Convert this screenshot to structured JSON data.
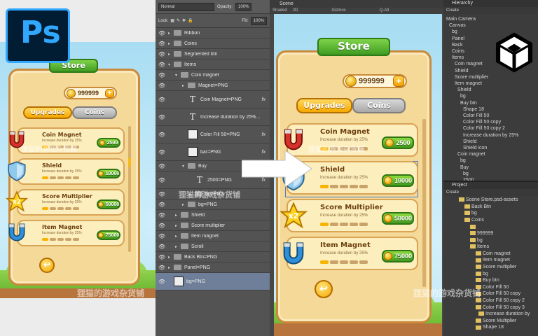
{
  "ps_logo": "Ps",
  "store_title": "Store",
  "coins_amount": "999999",
  "plus_label": "+",
  "tabs": {
    "upgrades": "Upgrades",
    "coins": "Coins"
  },
  "items": [
    {
      "title": "Coin Magnet",
      "desc": "Increase duration by 25%",
      "price": "2500",
      "level": 1,
      "icon": "horseshoe-magnet-icon"
    },
    {
      "title": "Shield",
      "desc": "Increase duration by 25%",
      "price": "10000",
      "level": 1,
      "icon": "shield-icon"
    },
    {
      "title": "Score Multiplier",
      "desc": "Increase duration by 25%",
      "price": "50000",
      "level": 1,
      "icon": "star-multiplier-icon"
    },
    {
      "title": "Item Magnet",
      "desc": "Increase duration by 25%",
      "price": "75000",
      "level": 1,
      "icon": "u-magnet-icon"
    }
  ],
  "back_label": "↩",
  "photoshop": {
    "blend_mode": "Normal",
    "opacity_label": "Opacity:",
    "opacity_value": "100%",
    "lock_label": "Lock:",
    "fill_label": "Fill:",
    "fill_value": "100%",
    "layers": [
      "Ribbon",
      "Coins",
      "Segmented btn",
      "Items",
      "Coin magnet",
      "Magnet=PNG",
      "Coin Magnet=PNG",
      "Increase duration by 25%...",
      "Color Fill 50=PNG",
      "bar=PNG",
      "Buy",
      "2500=PNG",
      "bg=PNG",
      "bg=PNG",
      "Shield",
      "Score multiplier",
      "Item magnet",
      "Scroll",
      "Back Btn=PNG",
      "Panel=PNG",
      "bg=PNG"
    ]
  },
  "unity": {
    "scene_tab": "Scene",
    "scene_toolbar": [
      "Shaded",
      "2D",
      "Gizmos",
      "Q-All"
    ],
    "hierarchy_tab": "Hierarchy",
    "hierarchy_create": "Create",
    "hierarchy": [
      "Main Camera",
      "Canvas",
      "bg",
      "Panel",
      "Back",
      "Coins",
      "Items",
      "Coin magnet",
      "Shield",
      "Score multiplier",
      "Item magnet",
      "Shield",
      "bg",
      "Buy btn",
      "Shape 18",
      "Color Fill 50",
      "Color Fill 50 copy",
      "Color Fill 50 copy 2",
      "Increase duration by 25%",
      "Shield",
      "Shield icon",
      "Coin magnet",
      "bg",
      "Buy",
      "bg",
      "2500"
    ],
    "project_tab": "Project",
    "project_create": "Create",
    "project": [
      "Scene Store.psd-assets",
      "Back Btn",
      "bg",
      "Coins",
      "",
      "999999",
      "bg",
      "Items",
      "Coin magnet",
      "Item magnet",
      "Score multiplier",
      "bg",
      "Buy btn",
      "Color Fill 50",
      "Color Fill 50 copy",
      "Color Fill 50 copy 2",
      "Color Fill 50 copy 3",
      "Increase duration by",
      "Score Multiplier",
      "Shape 18"
    ]
  },
  "watermark": "狸猫的游戏杂货铺"
}
